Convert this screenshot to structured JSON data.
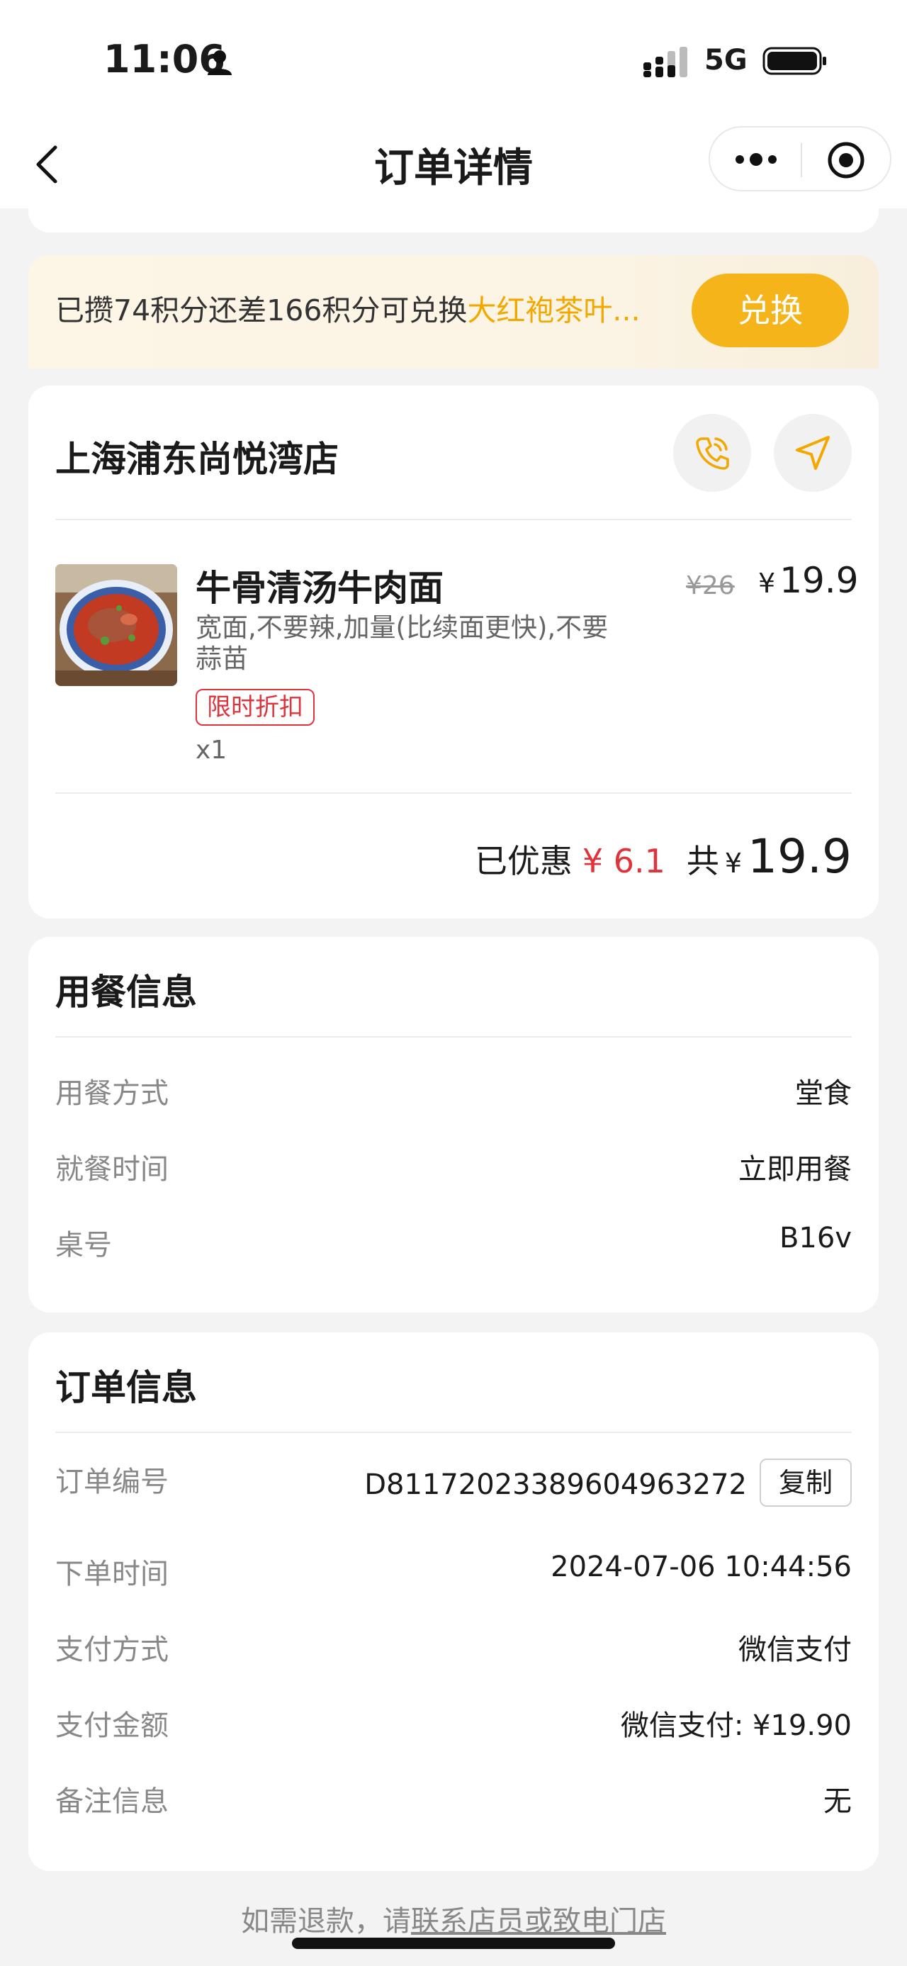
{
  "status_bar": {
    "time": "11:06",
    "network": "5G",
    "icons": [
      "person-icon",
      "signal-icon",
      "battery-icon"
    ]
  },
  "nav": {
    "title": "订单详情",
    "icons": [
      "back-icon",
      "more-icon",
      "target-icon"
    ]
  },
  "points": {
    "text_prefix": "已攒74积分还差166积分可兑换",
    "highlight": "大红袍茶叶...",
    "button": "兑换",
    "highlight_color": "#f2a800",
    "button_color": "#f4b41a"
  },
  "store": {
    "name": "上海浦东尚悦湾店",
    "icons": [
      "phone-icon",
      "navigate-icon"
    ],
    "item": {
      "name": "牛骨清汤牛肉面",
      "spec": "宽面,不要辣,加量(比续面更快),不要蒜苗",
      "tag": "限时折扣",
      "qty": "x1",
      "original_price": "¥26",
      "currency": "¥",
      "price": "19.9"
    },
    "summary": {
      "discount_label": "已优惠",
      "discount_value": "¥ 6.1",
      "total_label": "共",
      "total_currency": "¥",
      "total_value": "19.9",
      "discount_color": "#e0343c"
    }
  },
  "dine_info": {
    "title": "用餐信息",
    "rows": [
      {
        "key": "用餐方式",
        "value": "堂食"
      },
      {
        "key": "就餐时间",
        "value": "立即用餐"
      },
      {
        "key": "桌号",
        "value": "B16v"
      }
    ]
  },
  "order_info": {
    "title": "订单信息",
    "rows": [
      {
        "key": "订单编号",
        "value": "D8117202338960 4963272"
      },
      {
        "key": "下单时间",
        "value": "2024-07-06 10:44:56"
      },
      {
        "key": "支付方式",
        "value": "微信支付"
      },
      {
        "key": "支付金额",
        "value": "微信支付: ¥19.90"
      },
      {
        "key": "备注信息",
        "value": "无"
      }
    ],
    "copy_button": "复制"
  },
  "footer": {
    "prefix": "如需退款，请",
    "link": "联系店员或致电门店"
  }
}
